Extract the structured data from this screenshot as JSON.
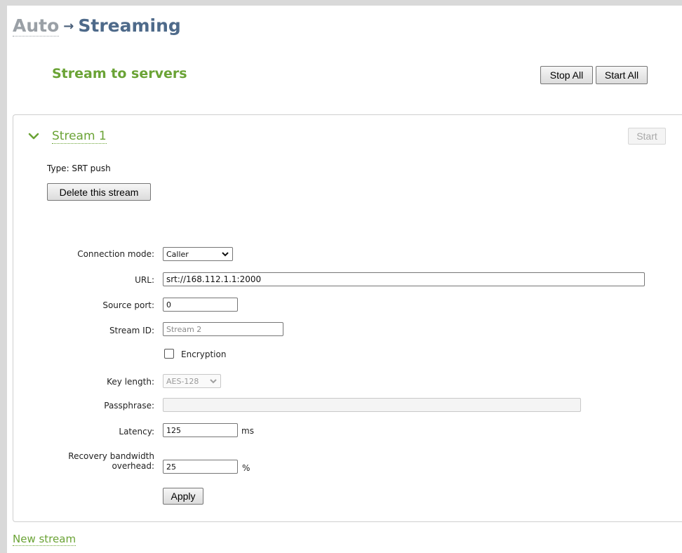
{
  "breadcrumb": {
    "parent": "Auto",
    "separator": "→",
    "current": "Streaming"
  },
  "section": {
    "title": "Stream to servers",
    "stop_all_label": "Stop All",
    "start_all_label": "Start All"
  },
  "stream": {
    "name": "Stream 1",
    "start_label": "Start",
    "type_text": "Type: SRT push",
    "delete_label": "Delete this stream",
    "fields": {
      "connection_mode": {
        "label": "Connection mode:",
        "value": "Caller"
      },
      "url": {
        "label": "URL:",
        "value": "srt://168.112.1.1:2000"
      },
      "source_port": {
        "label": "Source port:",
        "value": "0"
      },
      "stream_id": {
        "label": "Stream ID:",
        "placeholder": "Stream 2"
      },
      "encryption": {
        "label": "Encryption",
        "checked": false
      },
      "key_length": {
        "label": "Key length:",
        "value": "AES-128"
      },
      "passphrase": {
        "label": "Passphrase:",
        "value": ""
      },
      "latency": {
        "label": "Latency:",
        "value": "125",
        "unit": "ms"
      },
      "recovery_overhead": {
        "label_line1": "Recovery bandwidth",
        "label_line2": "overhead:",
        "value": "25",
        "unit": "%"
      }
    },
    "apply_label": "Apply"
  },
  "new_stream_label": "New stream",
  "colors": {
    "accent_green": "#6aa335",
    "title_blue": "#4e6a8a",
    "muted_gray": "#9aa0a6"
  },
  "icons": {
    "expand": "chevron-down-icon",
    "select_arrow": "chevron-down-icon"
  }
}
